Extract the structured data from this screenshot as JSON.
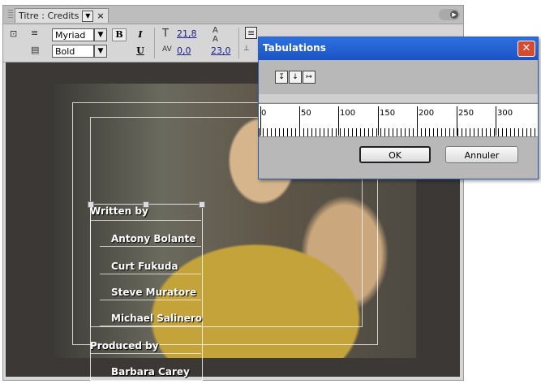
{
  "panel": {
    "tab_title": "Titre : Credits",
    "tab_menu_icon": "panel-menu-icon"
  },
  "toolbar": {
    "font_family": "Myriad ...",
    "font_style": "Bold",
    "bold_label": "B",
    "italic_label": "I",
    "underline_label": "U",
    "font_size": "21,8",
    "kerning": "0,0",
    "leading": "23,0",
    "icons": [
      "text-tool-icon",
      "tab-stops-icon",
      "templates-icon",
      "font-size-icon",
      "leading-icon",
      "kerning-icon",
      "align-left-icon",
      "align-center-icon",
      "align-right-icon"
    ]
  },
  "credits": {
    "heading1": "Written by",
    "names1": [
      "Antony Bolante",
      "Curt Fukuda",
      "Steve Muratore",
      "Michael Salinero"
    ],
    "heading2": "Produced by",
    "names2": [
      "Barbara Carey"
    ]
  },
  "dialog": {
    "title": "Tabulations",
    "tab_types": [
      "↧",
      "↓",
      "↦"
    ],
    "ruler_labels": [
      "0",
      "50",
      "100",
      "150",
      "200",
      "250",
      "300"
    ],
    "ok_label": "OK",
    "cancel_label": "Annuler"
  }
}
